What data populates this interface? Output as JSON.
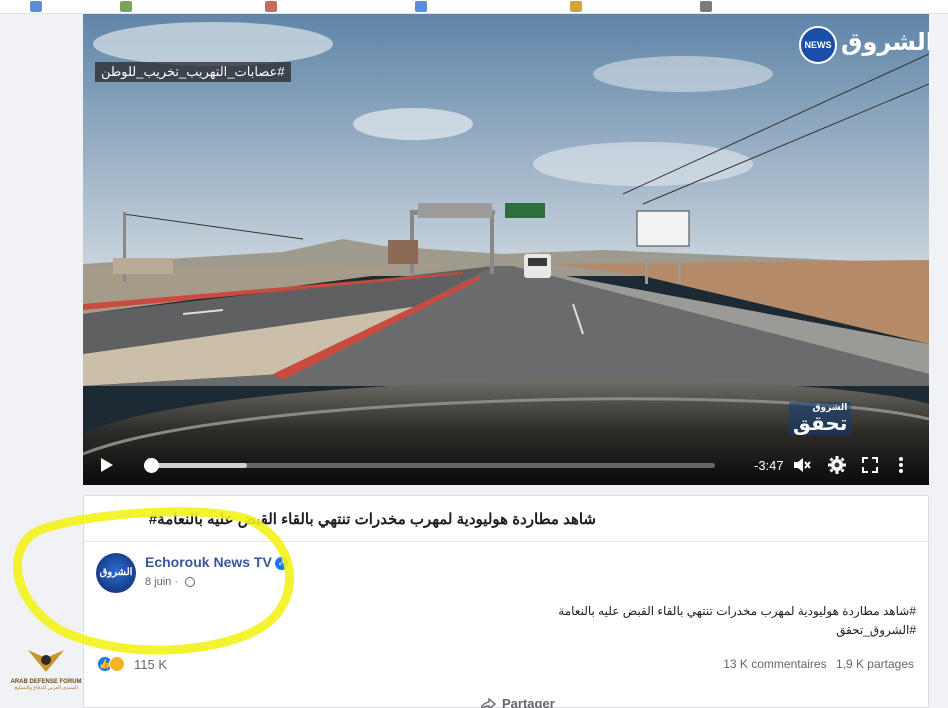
{
  "video": {
    "overlay_hashtag": "#عصابات_التهريب_تخريب_للوطن",
    "channel_logo_badge": "NEWS",
    "channel_logo_word": "الشروق",
    "corner_bug_small": "الشروق",
    "corner_bug": "تحقق",
    "time_remaining": "-3:47",
    "progress_fraction": 0.0,
    "buffered_fraction": 0.17,
    "icons": [
      "play-icon",
      "volume-muted-icon",
      "settings-gear-icon",
      "fullscreen-icon",
      "more-options-icon"
    ]
  },
  "post": {
    "title": "شاهد مطاردة هوليودية لمهرب مخدرات تنتهي بالقاء القبض عليه بالنعامة#",
    "page_name": "Echorouk News TV",
    "avatar_text": "الشروق",
    "date": "8 juin",
    "date_separator": "·",
    "body_line_1": "#شاهد مطاردة هوليودية لمهرب مخدرات تنتهي بالقاء القبض عليه بالنعامة",
    "body_line_2": "#الشروق_تحقق",
    "reaction_count": "115 K",
    "comments": "13 K commentaires",
    "shares": "1,9 K partages",
    "share_label": "Partager"
  },
  "watermark": {
    "line_1": "ARAB DEFENSE FORUM",
    "line_2": "المنتدى العربي للدفاع والتسليح"
  },
  "colors": {
    "link": "#385898",
    "verified": "#1877f2",
    "highlighter": "#f2f21a"
  }
}
